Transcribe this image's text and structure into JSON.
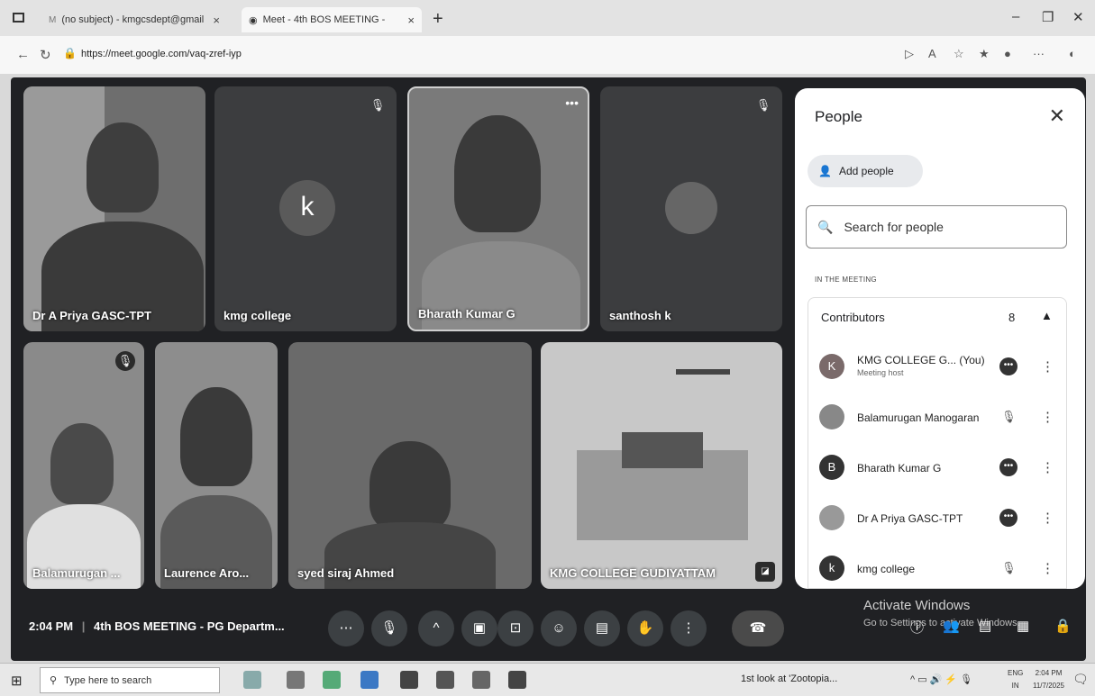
{
  "browser": {
    "tabs": [
      {
        "label": "(no subject) - kmgcsdept@gmail",
        "close": "×"
      },
      {
        "label": "Meet - 4th BOS MEETING - ",
        "close": "×"
      }
    ],
    "new_tab": "+",
    "url": "https://meet.google.com/vaq-zref-iyp",
    "window_controls": {
      "minimize": "–",
      "maximize": "❐",
      "close": "✕"
    }
  },
  "meeting": {
    "tiles": [
      {
        "name": "Dr A Priya GASC-TPT",
        "muted": false
      },
      {
        "name": "kmg college",
        "muted": true,
        "avatar_letter": "k"
      },
      {
        "name": "Bharath Kumar G",
        "muted": false,
        "active": true
      },
      {
        "name": "santhosh k",
        "muted": true
      },
      {
        "name": "Balamurugan ...",
        "muted": true
      },
      {
        "name": "Laurence Aro...",
        "muted": false
      },
      {
        "name": "syed siraj Ahmed",
        "muted": false
      },
      {
        "name": "KMG COLLEGE GUDIYATTAM",
        "muted": false
      }
    ],
    "time": "2:04 PM",
    "separator": "|",
    "title": "4th BOS MEETING - PG Departm..."
  },
  "people_panel": {
    "title": "People",
    "add_people": "Add people",
    "search_placeholder": "Search for people",
    "section": "IN THE MEETING",
    "group": {
      "label": "Contributors",
      "count": "8"
    },
    "participants": [
      {
        "initial": "K",
        "name": "KMG COLLEGE G... (You)",
        "role": "Meeting host",
        "state": "more"
      },
      {
        "initial": "",
        "name": "Balamurugan Manogaran",
        "role": "",
        "state": "muted"
      },
      {
        "initial": "B",
        "name": "Bharath Kumar G",
        "role": "",
        "state": "more"
      },
      {
        "initial": "",
        "name": "Dr A Priya GASC-TPT",
        "role": "",
        "state": "more"
      },
      {
        "initial": "k",
        "name": "kmg college",
        "role": "",
        "state": "muted"
      }
    ]
  },
  "watermark": {
    "line1": "Activate Windows",
    "line2": "Go to Settings to activate Windows."
  },
  "taskbar": {
    "search_placeholder": "Type here to search",
    "news": "1st look at 'Zootopia...",
    "lang": [
      "ENG",
      "IN"
    ],
    "clock": [
      "2:04 PM",
      "11/7/2025"
    ]
  },
  "colors": {
    "meet_bg": "#202124",
    "panel_bg": "#ffffff",
    "end_call": "#4a4a4a"
  }
}
